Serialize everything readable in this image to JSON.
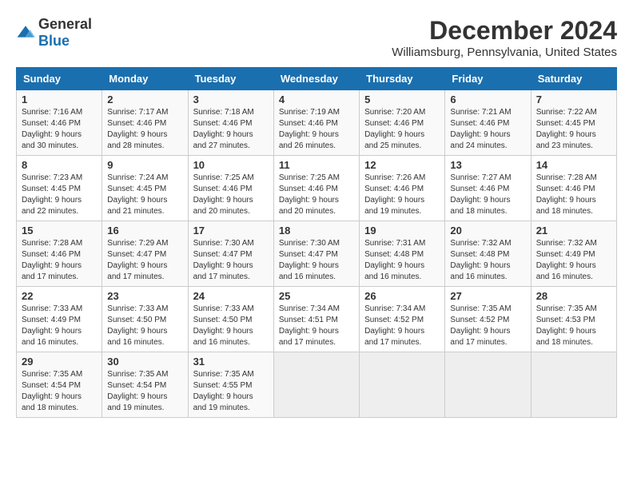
{
  "logo": {
    "general": "General",
    "blue": "Blue"
  },
  "title": {
    "month": "December 2024",
    "location": "Williamsburg, Pennsylvania, United States"
  },
  "days_of_week": [
    "Sunday",
    "Monday",
    "Tuesday",
    "Wednesday",
    "Thursday",
    "Friday",
    "Saturday"
  ],
  "weeks": [
    [
      {
        "day": "1",
        "sunrise": "7:16 AM",
        "sunset": "4:46 PM",
        "daylight": "9 hours and 30 minutes."
      },
      {
        "day": "2",
        "sunrise": "7:17 AM",
        "sunset": "4:46 PM",
        "daylight": "9 hours and 28 minutes."
      },
      {
        "day": "3",
        "sunrise": "7:18 AM",
        "sunset": "4:46 PM",
        "daylight": "9 hours and 27 minutes."
      },
      {
        "day": "4",
        "sunrise": "7:19 AM",
        "sunset": "4:46 PM",
        "daylight": "9 hours and 26 minutes."
      },
      {
        "day": "5",
        "sunrise": "7:20 AM",
        "sunset": "4:46 PM",
        "daylight": "9 hours and 25 minutes."
      },
      {
        "day": "6",
        "sunrise": "7:21 AM",
        "sunset": "4:46 PM",
        "daylight": "9 hours and 24 minutes."
      },
      {
        "day": "7",
        "sunrise": "7:22 AM",
        "sunset": "4:45 PM",
        "daylight": "9 hours and 23 minutes."
      }
    ],
    [
      {
        "day": "8",
        "sunrise": "7:23 AM",
        "sunset": "4:45 PM",
        "daylight": "9 hours and 22 minutes."
      },
      {
        "day": "9",
        "sunrise": "7:24 AM",
        "sunset": "4:45 PM",
        "daylight": "9 hours and 21 minutes."
      },
      {
        "day": "10",
        "sunrise": "7:25 AM",
        "sunset": "4:46 PM",
        "daylight": "9 hours and 20 minutes."
      },
      {
        "day": "11",
        "sunrise": "7:25 AM",
        "sunset": "4:46 PM",
        "daylight": "9 hours and 20 minutes."
      },
      {
        "day": "12",
        "sunrise": "7:26 AM",
        "sunset": "4:46 PM",
        "daylight": "9 hours and 19 minutes."
      },
      {
        "day": "13",
        "sunrise": "7:27 AM",
        "sunset": "4:46 PM",
        "daylight": "9 hours and 18 minutes."
      },
      {
        "day": "14",
        "sunrise": "7:28 AM",
        "sunset": "4:46 PM",
        "daylight": "9 hours and 18 minutes."
      }
    ],
    [
      {
        "day": "15",
        "sunrise": "7:28 AM",
        "sunset": "4:46 PM",
        "daylight": "9 hours and 17 minutes."
      },
      {
        "day": "16",
        "sunrise": "7:29 AM",
        "sunset": "4:47 PM",
        "daylight": "9 hours and 17 minutes."
      },
      {
        "day": "17",
        "sunrise": "7:30 AM",
        "sunset": "4:47 PM",
        "daylight": "9 hours and 17 minutes."
      },
      {
        "day": "18",
        "sunrise": "7:30 AM",
        "sunset": "4:47 PM",
        "daylight": "9 hours and 16 minutes."
      },
      {
        "day": "19",
        "sunrise": "7:31 AM",
        "sunset": "4:48 PM",
        "daylight": "9 hours and 16 minutes."
      },
      {
        "day": "20",
        "sunrise": "7:32 AM",
        "sunset": "4:48 PM",
        "daylight": "9 hours and 16 minutes."
      },
      {
        "day": "21",
        "sunrise": "7:32 AM",
        "sunset": "4:49 PM",
        "daylight": "9 hours and 16 minutes."
      }
    ],
    [
      {
        "day": "22",
        "sunrise": "7:33 AM",
        "sunset": "4:49 PM",
        "daylight": "9 hours and 16 minutes."
      },
      {
        "day": "23",
        "sunrise": "7:33 AM",
        "sunset": "4:50 PM",
        "daylight": "9 hours and 16 minutes."
      },
      {
        "day": "24",
        "sunrise": "7:33 AM",
        "sunset": "4:50 PM",
        "daylight": "9 hours and 16 minutes."
      },
      {
        "day": "25",
        "sunrise": "7:34 AM",
        "sunset": "4:51 PM",
        "daylight": "9 hours and 17 minutes."
      },
      {
        "day": "26",
        "sunrise": "7:34 AM",
        "sunset": "4:52 PM",
        "daylight": "9 hours and 17 minutes."
      },
      {
        "day": "27",
        "sunrise": "7:35 AM",
        "sunset": "4:52 PM",
        "daylight": "9 hours and 17 minutes."
      },
      {
        "day": "28",
        "sunrise": "7:35 AM",
        "sunset": "4:53 PM",
        "daylight": "9 hours and 18 minutes."
      }
    ],
    [
      {
        "day": "29",
        "sunrise": "7:35 AM",
        "sunset": "4:54 PM",
        "daylight": "9 hours and 18 minutes."
      },
      {
        "day": "30",
        "sunrise": "7:35 AM",
        "sunset": "4:54 PM",
        "daylight": "9 hours and 19 minutes."
      },
      {
        "day": "31",
        "sunrise": "7:35 AM",
        "sunset": "4:55 PM",
        "daylight": "9 hours and 19 minutes."
      },
      null,
      null,
      null,
      null
    ]
  ]
}
